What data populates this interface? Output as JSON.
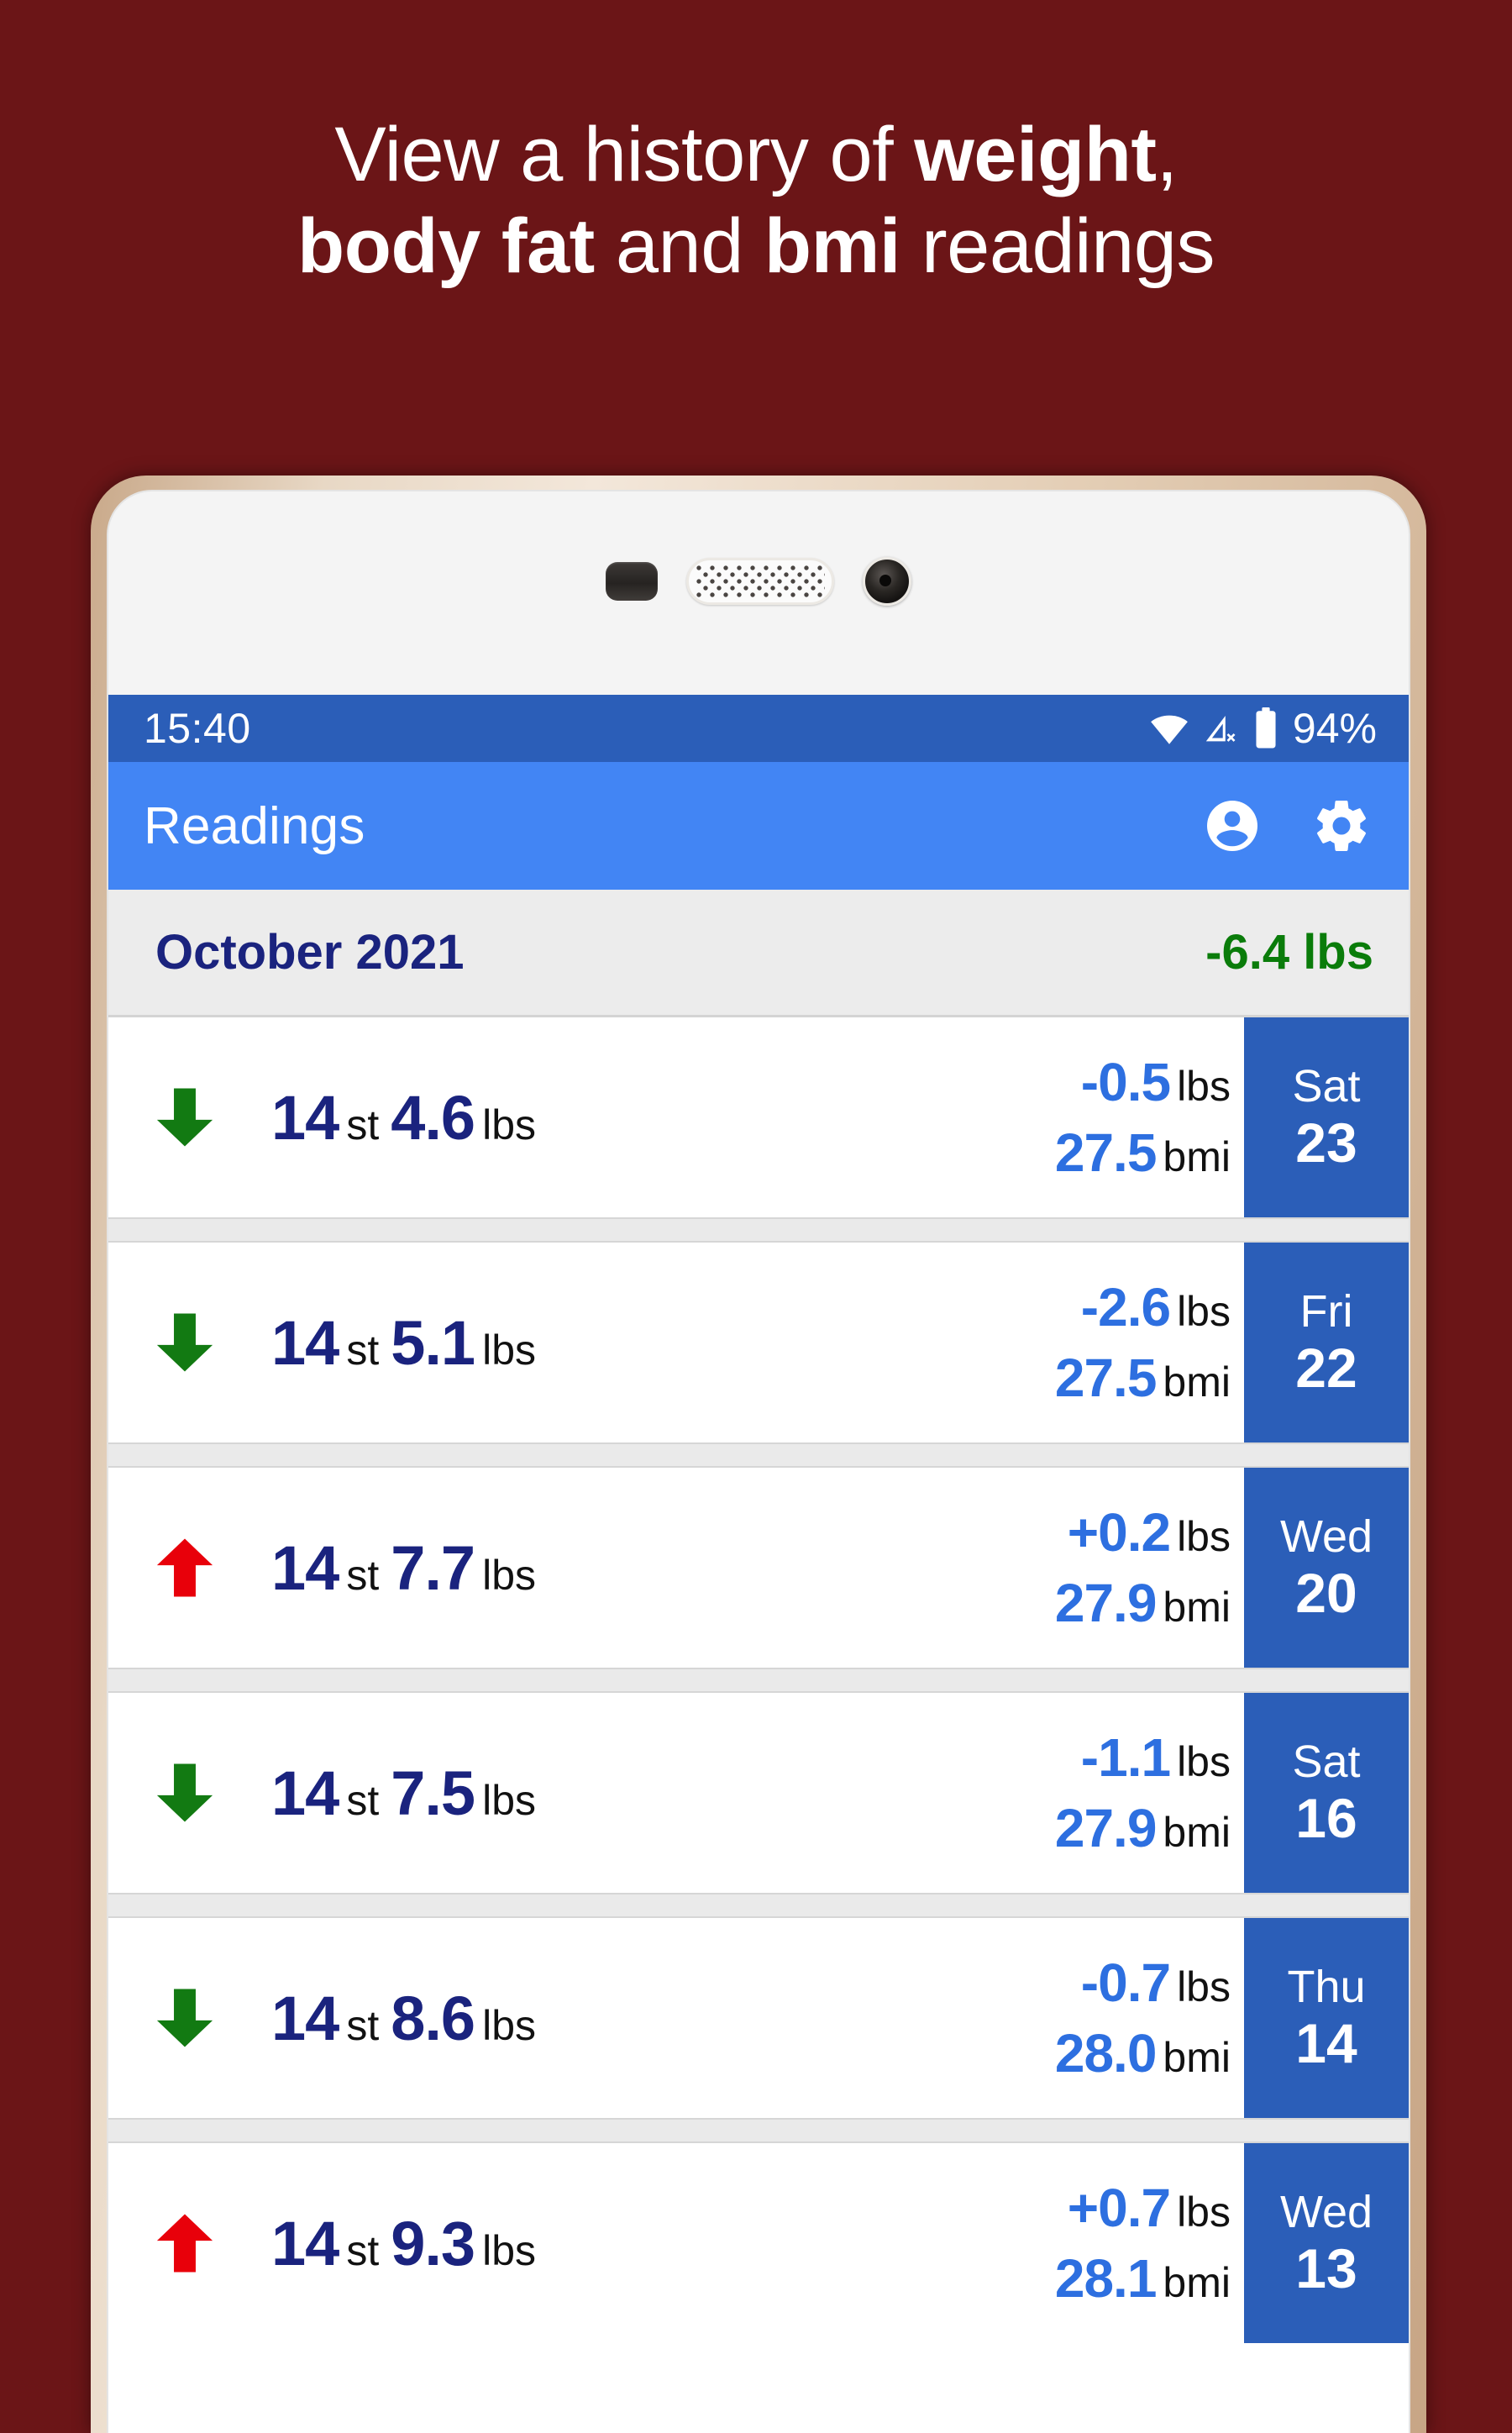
{
  "promo": {
    "headline_lines": [
      [
        {
          "text": "View a history of ",
          "bold": false
        },
        {
          "text": "weight",
          "bold": true
        },
        {
          "text": ",",
          "bold": false
        }
      ],
      [
        {
          "text": "body fat",
          "bold": true
        },
        {
          "text": " and ",
          "bold": false
        },
        {
          "text": "bmi",
          "bold": true
        },
        {
          "text": " readings",
          "bold": false
        }
      ]
    ],
    "background_color": "#6B1517",
    "text_color": "#FFFFFF"
  },
  "device": {
    "frame_color": "#E3CDB4",
    "bezel_color": "#F4F4F4",
    "sensors": [
      {
        "name": "proximity-sensor"
      },
      {
        "name": "earpiece-speaker"
      },
      {
        "name": "front-camera"
      }
    ]
  },
  "statusbar": {
    "time": "15:40",
    "battery_percent": "94%",
    "background_color": "#2B5EB8",
    "icons": [
      "wifi-icon",
      "signal-off-icon",
      "battery-icon"
    ]
  },
  "appbar": {
    "title": "Readings",
    "background_color": "#4285F4",
    "actions": [
      {
        "name": "account-icon",
        "label": "Account"
      },
      {
        "name": "settings-gear-icon",
        "label": "Settings"
      }
    ]
  },
  "month_header": {
    "label": "October 2021",
    "delta": "-6.4 lbs",
    "label_color": "#1A237E",
    "delta_color": "#0A7C0A",
    "background_color": "#ECECEC"
  },
  "colors": {
    "weight_number": "#1A237E",
    "unit_text": "#111111",
    "stat_value": "#2D6FE0",
    "date_block": "#2B5EB8",
    "arrow_down": "#127A12",
    "arrow_up": "#E8000A"
  },
  "readings": [
    {
      "trend": "down",
      "stone": "14",
      "stone_unit": "st",
      "pounds": "4.6",
      "pounds_unit": "lbs",
      "delta": "-0.5",
      "delta_unit": "lbs",
      "bmi": "27.5",
      "bmi_unit": "bmi",
      "day_of_week": "Sat",
      "day_number": "23"
    },
    {
      "trend": "down",
      "stone": "14",
      "stone_unit": "st",
      "pounds": "5.1",
      "pounds_unit": "lbs",
      "delta": "-2.6",
      "delta_unit": "lbs",
      "bmi": "27.5",
      "bmi_unit": "bmi",
      "day_of_week": "Fri",
      "day_number": "22"
    },
    {
      "trend": "up",
      "stone": "14",
      "stone_unit": "st",
      "pounds": "7.7",
      "pounds_unit": "lbs",
      "delta": "+0.2",
      "delta_unit": "lbs",
      "bmi": "27.9",
      "bmi_unit": "bmi",
      "day_of_week": "Wed",
      "day_number": "20"
    },
    {
      "trend": "down",
      "stone": "14",
      "stone_unit": "st",
      "pounds": "7.5",
      "pounds_unit": "lbs",
      "delta": "-1.1",
      "delta_unit": "lbs",
      "bmi": "27.9",
      "bmi_unit": "bmi",
      "day_of_week": "Sat",
      "day_number": "16"
    },
    {
      "trend": "down",
      "stone": "14",
      "stone_unit": "st",
      "pounds": "8.6",
      "pounds_unit": "lbs",
      "delta": "-0.7",
      "delta_unit": "lbs",
      "bmi": "28.0",
      "bmi_unit": "bmi",
      "day_of_week": "Thu",
      "day_number": "14"
    },
    {
      "trend": "up",
      "stone": "14",
      "stone_unit": "st",
      "pounds": "9.3",
      "pounds_unit": "lbs",
      "delta": "+0.7",
      "delta_unit": "lbs",
      "bmi": "28.1",
      "bmi_unit": "bmi",
      "day_of_week": "Wed",
      "day_number": "13"
    }
  ]
}
